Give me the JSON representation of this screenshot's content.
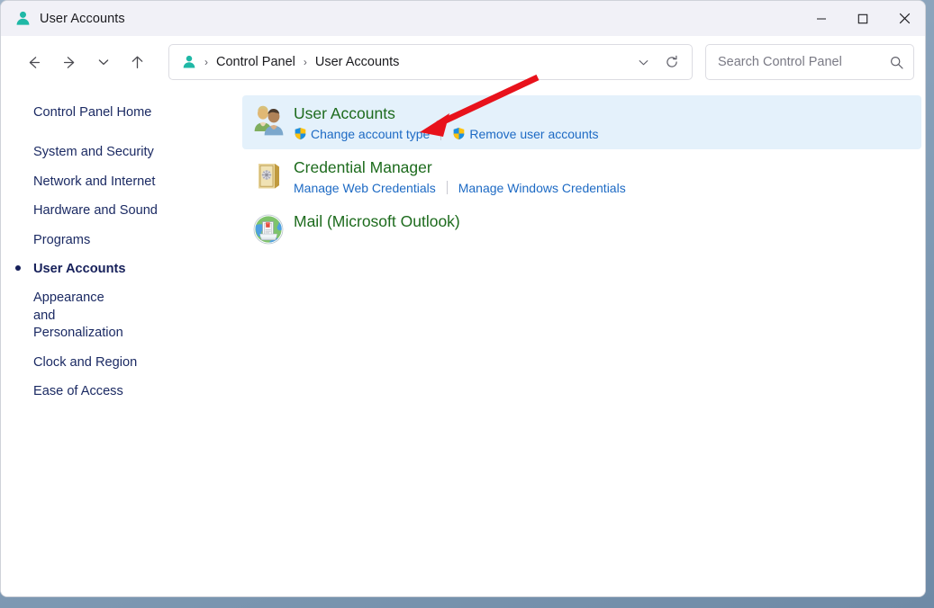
{
  "window": {
    "title": "User Accounts",
    "title_icon": "user-account-icon",
    "controls": {
      "minimize_label": "Minimize",
      "maximize_label": "Maximize",
      "close_label": "Close"
    }
  },
  "navbar": {
    "back_label": "Back",
    "forward_label": "Forward",
    "recent_label": "Recent locations",
    "up_label": "Up one level",
    "address": {
      "icon": "user-account-icon",
      "crumbs": [
        "Control Panel",
        "User Accounts"
      ],
      "separator": "›",
      "dropdown_label": "Previous locations",
      "refresh_label": "Refresh"
    },
    "search": {
      "placeholder": "Search Control Panel",
      "value": "",
      "icon": "search-icon"
    }
  },
  "sidebar": {
    "items": [
      {
        "label": "Control Panel Home",
        "current": false
      },
      {
        "label": "System and Security",
        "current": false
      },
      {
        "label": "Network and Internet",
        "current": false
      },
      {
        "label": "Hardware and Sound",
        "current": false
      },
      {
        "label": "Programs",
        "current": false
      },
      {
        "label": "User Accounts",
        "current": true
      },
      {
        "label": "Appearance and Personalization",
        "current": false
      },
      {
        "label": "Clock and Region",
        "current": false
      },
      {
        "label": "Ease of Access",
        "current": false
      }
    ]
  },
  "content": {
    "categories": [
      {
        "title": "User Accounts",
        "icon": "user-accounts-icon",
        "selected": true,
        "links": [
          {
            "label": "Change account type",
            "shield": true
          },
          {
            "label": "Remove user accounts",
            "shield": true
          }
        ]
      },
      {
        "title": "Credential Manager",
        "icon": "credential-vault-icon",
        "selected": false,
        "links": [
          {
            "label": "Manage Web Credentials",
            "shield": false
          },
          {
            "label": "Manage Windows Credentials",
            "shield": false
          }
        ]
      },
      {
        "title": "Mail (Microsoft Outlook)",
        "icon": "mail-globe-icon",
        "selected": false,
        "links": []
      }
    ]
  },
  "annotation": {
    "type": "arrow",
    "color": "#e8121b",
    "points_to": "User Accounts"
  },
  "colors": {
    "titlebar_bg": "#f1f1f7",
    "sidebar_text": "#1b2a63",
    "category_title": "#1d6b1d",
    "sublink": "#1d6ac4",
    "selection_bg": "#e4f1fb",
    "accent_teal": "#1fb8a6",
    "annotation_red": "#e8121b"
  }
}
